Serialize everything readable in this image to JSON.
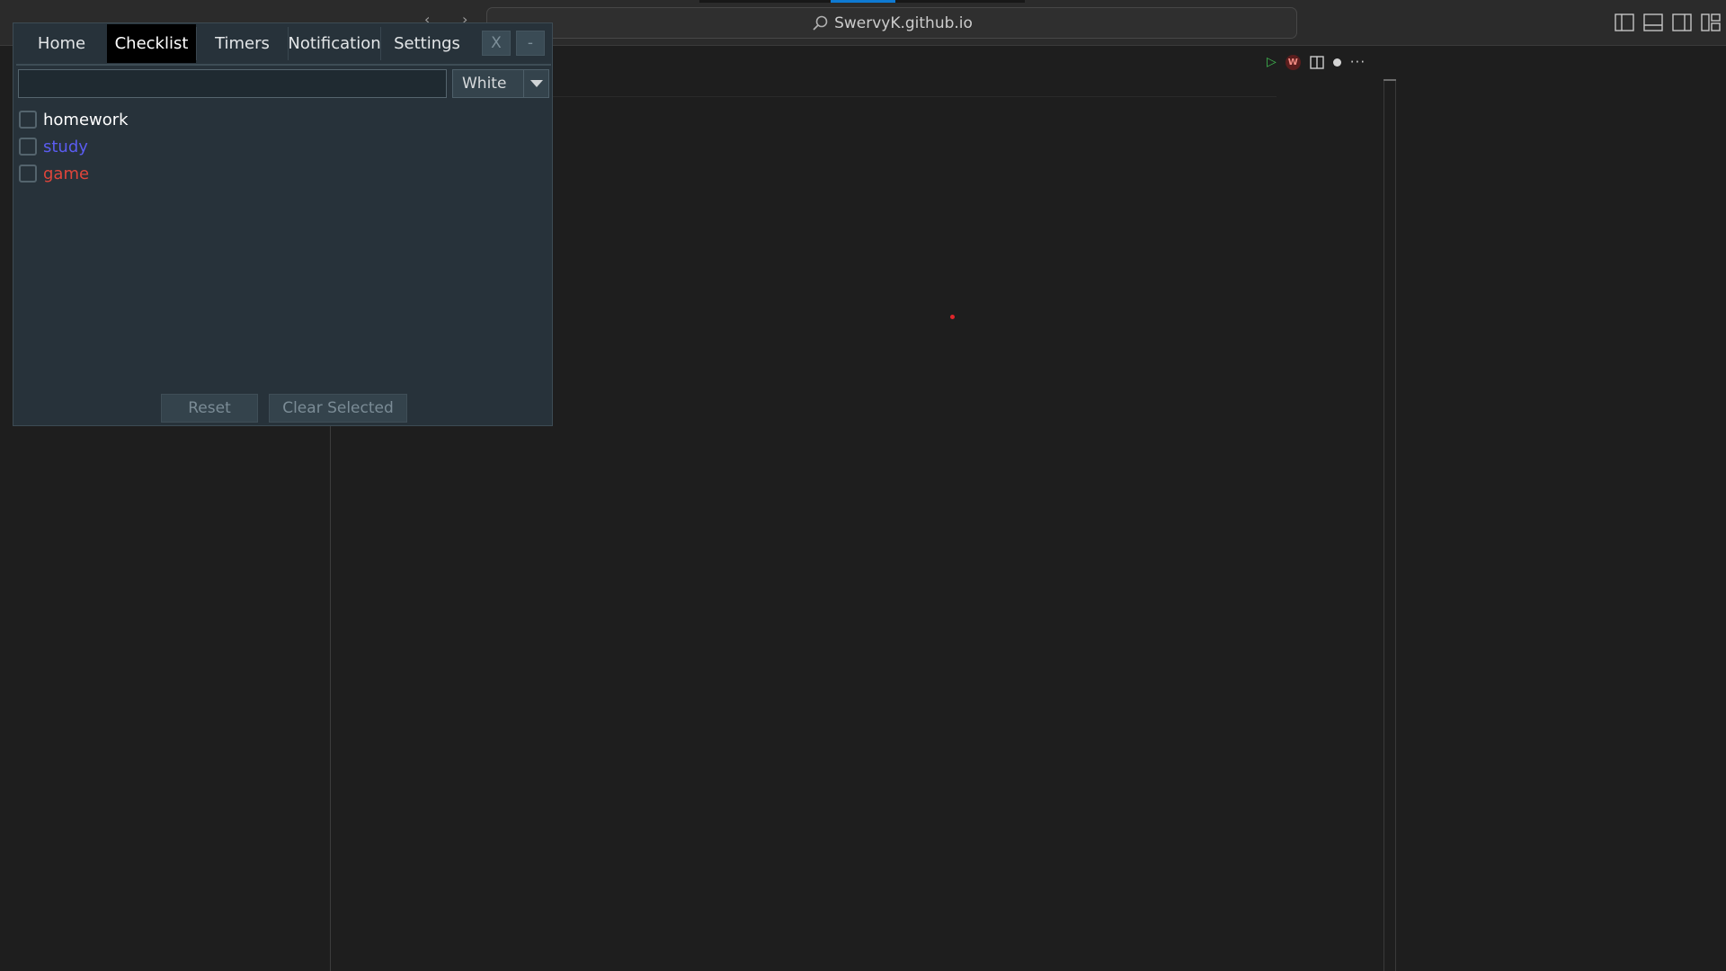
{
  "titlebar": {
    "back_icon": "chevron-left-icon",
    "forward_icon": "chevron-right-icon",
    "search_text": "SwervyK.github.io",
    "layout_icons": [
      "toggle-primary-sidebar-icon",
      "toggle-panel-icon",
      "toggle-secondary-sidebar-icon",
      "customize-layout-icon"
    ]
  },
  "editor_actions": {
    "run_icon": "run-icon",
    "w_badge": "W",
    "split_icon": "split-editor-icon",
    "unsaved_icon": "unsaved-dot-icon",
    "more": "···"
  },
  "overlay": {
    "tabs": [
      {
        "label": "Home"
      },
      {
        "label": "Checklist",
        "active": true
      },
      {
        "label": "Timers"
      },
      {
        "label": "Notification"
      },
      {
        "label": "Settings"
      }
    ],
    "close_label": "X",
    "minimize_label": "-",
    "input": {
      "value": "",
      "placeholder": ""
    },
    "color_select": {
      "selected": "White"
    },
    "items": [
      {
        "label": "homework",
        "color": "#ffffff",
        "checked": false
      },
      {
        "label": "study",
        "color": "#5a5cf0",
        "checked": false
      },
      {
        "label": "game",
        "color": "#e0453a",
        "checked": false
      }
    ],
    "reset_label": "Reset",
    "clear_selected_label": "Clear Selected"
  },
  "colors": {
    "accent": "#0e7ad3",
    "overlay_bg": "#27323a",
    "active_tab_bg": "#000000",
    "editor_bg": "#1e1e1e"
  }
}
